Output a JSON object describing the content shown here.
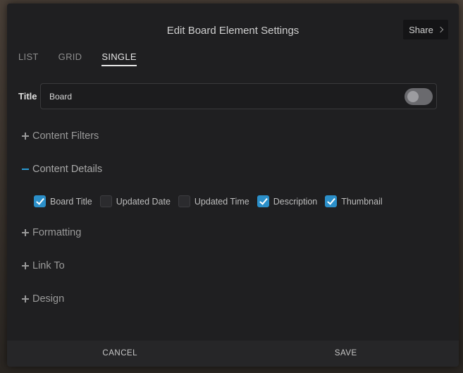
{
  "dialog": {
    "title": "Edit Board Element Settings",
    "share_label": "Share"
  },
  "tabs": [
    {
      "label": "LIST",
      "active": false
    },
    {
      "label": "GRID",
      "active": false
    },
    {
      "label": "SINGLE",
      "active": true
    }
  ],
  "title_field": {
    "label": "Title",
    "value": "Board",
    "toggle_on": false
  },
  "sections": {
    "content_filters": {
      "label": "Content Filters",
      "expanded": false
    },
    "content_details": {
      "label": "Content Details",
      "expanded": true
    },
    "formatting": {
      "label": "Formatting",
      "expanded": false
    },
    "link_to": {
      "label": "Link To",
      "expanded": false
    },
    "design": {
      "label": "Design",
      "expanded": false
    }
  },
  "content_details_options": [
    {
      "label": "Board Title",
      "checked": true
    },
    {
      "label": "Updated Date",
      "checked": false
    },
    {
      "label": "Updated Time",
      "checked": false
    },
    {
      "label": "Description",
      "checked": true
    },
    {
      "label": "Thumbnail",
      "checked": true
    }
  ],
  "footer": {
    "cancel_label": "CANCEL",
    "save_label": "SAVE"
  },
  "colors": {
    "accent": "#2b8fc9",
    "modal_bg": "#1f1f21",
    "footer_bg": "#262628"
  },
  "icons": {
    "share": "chevron-right-icon",
    "collapsed": "plus-icon",
    "expanded": "minus-icon",
    "checked": "checkmark-icon"
  }
}
